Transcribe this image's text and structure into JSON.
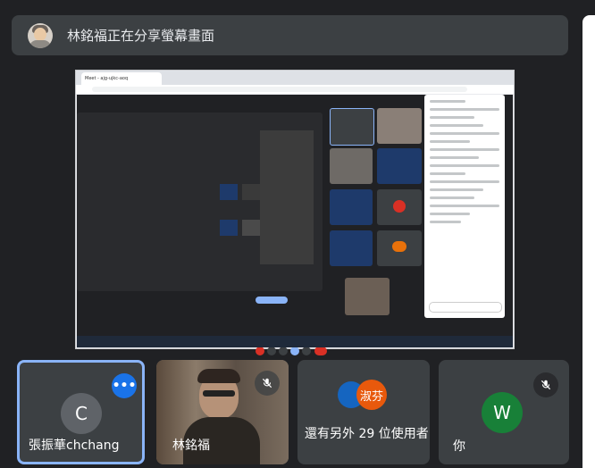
{
  "banner": {
    "text": "林銘福正在分享螢幕畫面"
  },
  "shared_screen": {
    "tab_title": "Meet - ajg-ujkc-aoq"
  },
  "participants": [
    {
      "name": "張振華chchang",
      "initial": "C",
      "avatar_color": "#5f6368",
      "selected": true
    },
    {
      "name": "林銘福",
      "muted": true
    },
    {
      "name": "還有另外 29 位使用者",
      "stack_initial": "淑芬",
      "stack_color": "#e8590c"
    },
    {
      "name": "你",
      "initial": "W",
      "avatar_color": "#188038",
      "muted": true
    }
  ],
  "icons": {
    "more": "more-options-icon",
    "mic_off": "mic-off-icon"
  },
  "colors": {
    "background": "#202124",
    "tile": "#3c4043",
    "accent": "#1a73e8",
    "selected_border": "#8ab4f8"
  }
}
